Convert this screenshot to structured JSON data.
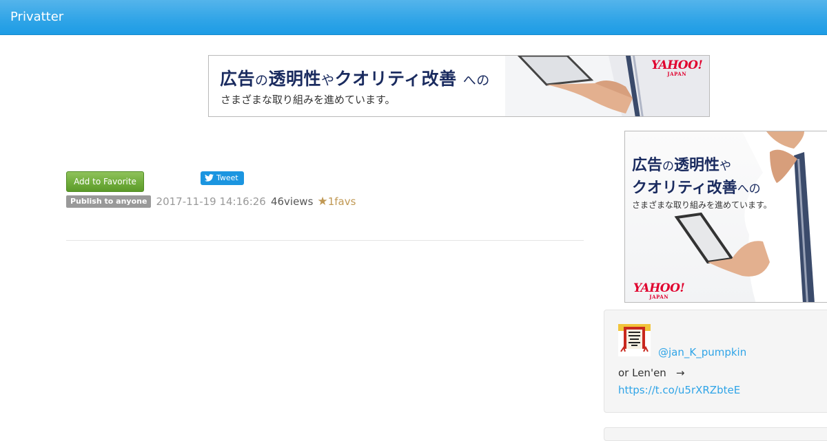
{
  "navbar": {
    "brand": "Privatter"
  },
  "ad_top": {
    "headline_parts": [
      "広告",
      "の",
      "透明性",
      "や",
      "クオリティ改善",
      "への"
    ],
    "sub": "さまざまな取り組みを進めています。",
    "logo_word": "YAHOO!",
    "logo_sub": "JAPAN"
  },
  "ad_side": {
    "line1_parts": [
      "広告",
      "の",
      "透明性",
      "や"
    ],
    "line2_parts": [
      "クオリティ改善",
      "への"
    ],
    "sub": "さまざまな取り組みを進めています。",
    "logo_word": "YAHOO!",
    "logo_sub": "JAPAN"
  },
  "post": {
    "favorite_label": "Add to Favorite",
    "tweet_label": "Tweet",
    "visibility_badge": "Publish to anyone",
    "timestamp": "2017-11-19 14:16:26",
    "views": "46views",
    "fav_star": "★",
    "favs": "1favs"
  },
  "profile": {
    "handle": "@jan_K_pumpkin",
    "bio": "or Len'en",
    "bio_arrow": "→",
    "link": "https://t.co/u5rXRZbteE"
  },
  "colors": {
    "navbar": "#2fa4e7",
    "link": "#2fa4e7",
    "favorite_button": "#6eab3a",
    "tweet_button": "#1b95e0",
    "badge": "#999999",
    "favs": "#c09853"
  }
}
